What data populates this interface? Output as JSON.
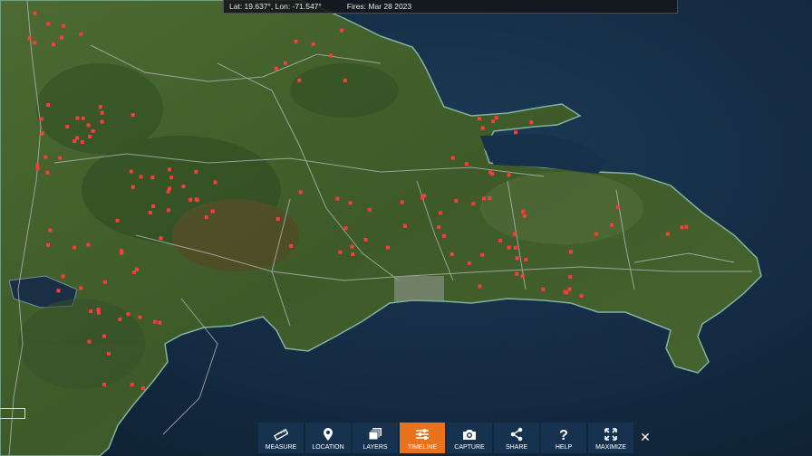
{
  "status": {
    "coords": "Lat: 19.637°, Lon: -71.547°",
    "fires": "Fires: Mar 28 2023"
  },
  "toolbar": [
    {
      "label": "MEASURE",
      "icon": "ruler-icon",
      "active": false
    },
    {
      "label": "LOCATION",
      "icon": "location-pin-icon",
      "active": false
    },
    {
      "label": "LAYERS",
      "icon": "layers-icon",
      "active": false
    },
    {
      "label": "TIMELINE",
      "icon": "sliders-icon",
      "active": true
    },
    {
      "label": "CAPTURE",
      "icon": "camera-icon",
      "active": false
    },
    {
      "label": "SHARE",
      "icon": "share-icon",
      "active": false
    },
    {
      "label": "HELP",
      "icon": "question-icon",
      "active": false
    },
    {
      "label": "MAXIMIZE",
      "icon": "expand-arrows-icon",
      "active": false
    }
  ],
  "close": "✕",
  "colors": {
    "fire": "#ff3b3b",
    "land": "#3f5a2a",
    "water": "#17304b",
    "active": "#e8731c"
  }
}
